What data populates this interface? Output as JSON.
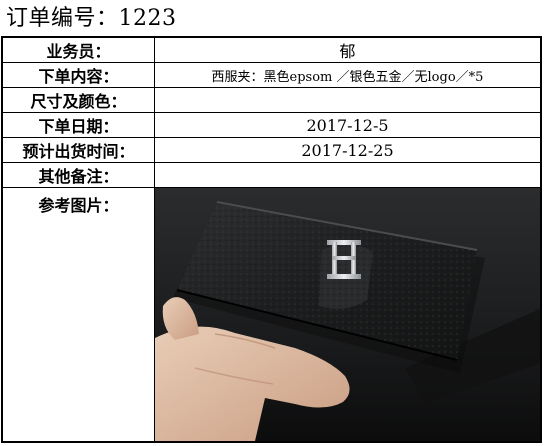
{
  "order": {
    "title": "订单编号：1223"
  },
  "rows": [
    {
      "label": "业务员：",
      "value": "郁"
    },
    {
      "label": "下单内容：",
      "value": "西服夹：黑色epsom ／银色五金／无logo／*5"
    },
    {
      "label": "尺寸及颜色：",
      "value": ""
    },
    {
      "label": "下单日期：",
      "value": "2017-12-5"
    },
    {
      "label": "预计出货时间：",
      "value": "2017-12-25"
    },
    {
      "label": "其他备注：",
      "value": ""
    },
    {
      "label": "参考图片：",
      "value": ""
    }
  ],
  "colors": {
    "border": "#000000",
    "background": "#ffffff",
    "wallet": "#1c1d1e",
    "hardware": "#c9cbcf"
  }
}
